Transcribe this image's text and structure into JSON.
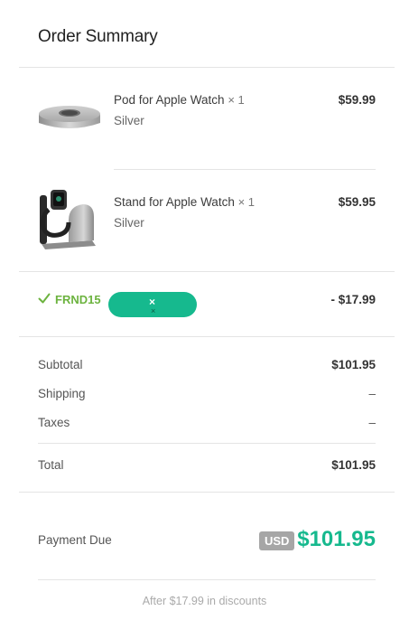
{
  "header": {
    "title": "Order Summary"
  },
  "items": [
    {
      "name": "Pod for Apple Watch",
      "qty": "× 1",
      "variant": "Silver",
      "price": "$59.99",
      "icon": "pod-image"
    },
    {
      "name": "Stand for Apple Watch",
      "qty": "× 1",
      "variant": "Silver",
      "price": "$59.95",
      "icon": "stand-image"
    }
  ],
  "discount": {
    "code": "FRND15",
    "amount": "- $17.99",
    "remove_top": "×",
    "remove_bottom": "×",
    "icon": "check-icon",
    "color": "#6cb33f",
    "button_color": "#16b98e"
  },
  "totals": {
    "subtotal_label": "Subtotal",
    "subtotal": "$101.95",
    "shipping_label": "Shipping",
    "shipping": "–",
    "taxes_label": "Taxes",
    "taxes": "–",
    "total_label": "Total",
    "total": "$101.95"
  },
  "payment": {
    "label": "Payment Due",
    "currency": "USD",
    "amount": "$101.95",
    "note": "After $17.99 in discounts",
    "accent": "#16b98e"
  }
}
